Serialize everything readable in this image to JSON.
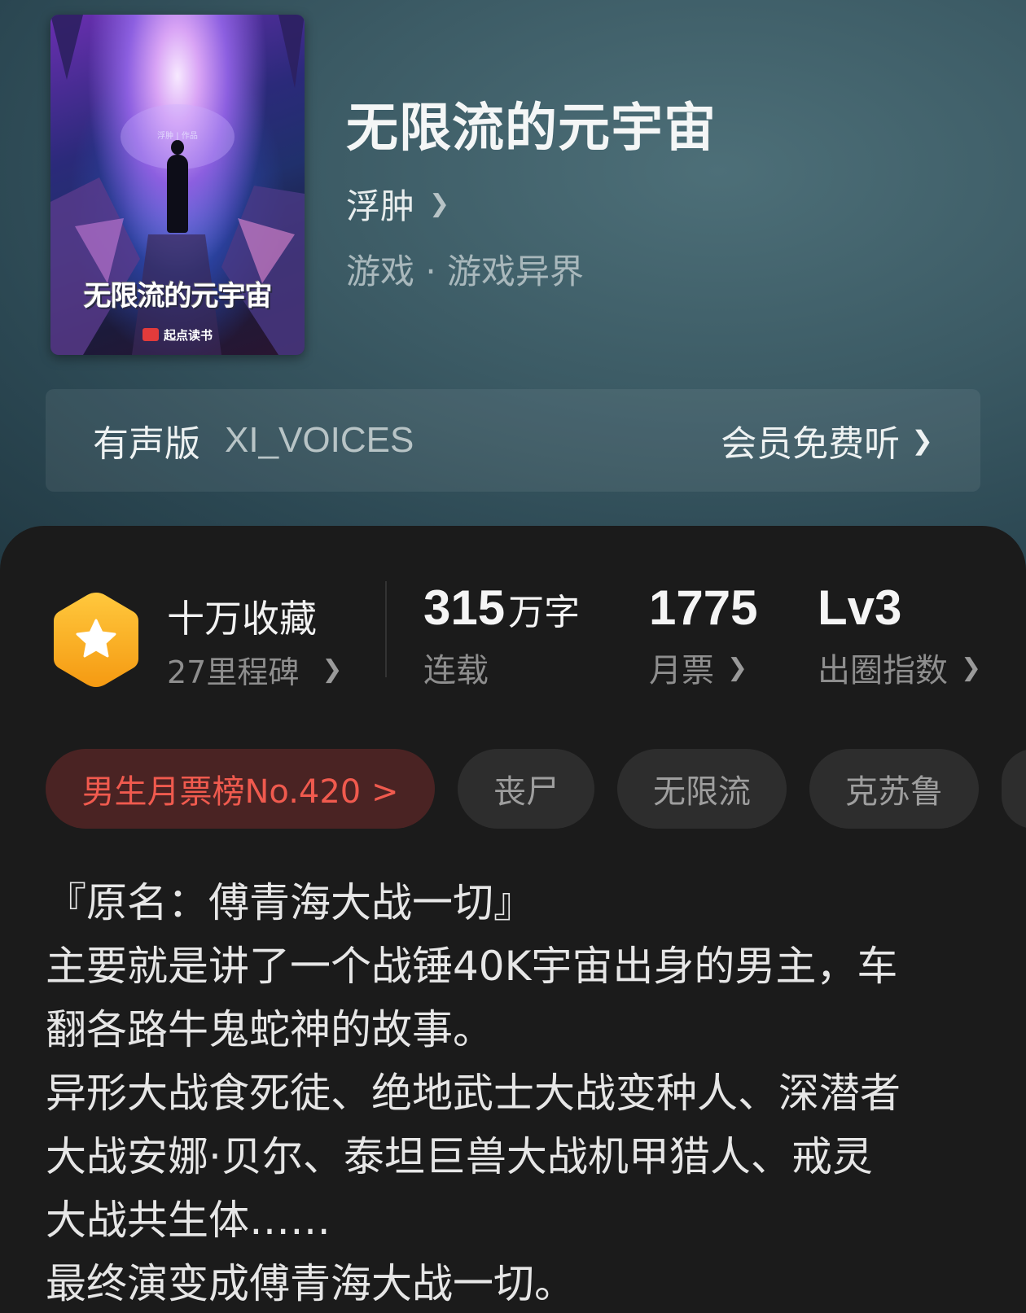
{
  "book": {
    "title": "无限流的元宇宙",
    "author": "浮肿",
    "genre": "游戏 · 游戏异界",
    "cover": {
      "title_art": "无限流的元宇宙",
      "publisher": "起点读书",
      "byline": "浮肿 | 作品"
    }
  },
  "audio": {
    "label": "有声版",
    "voice": "XI_VOICES",
    "cta": "会员免费听"
  },
  "stats": {
    "favorites": {
      "title": "十万收藏",
      "sub": "27里程碑"
    },
    "words": {
      "value": "315",
      "unit": "万字",
      "label": "连载"
    },
    "monthly_tickets": {
      "value": "1775",
      "label": "月票"
    },
    "level": {
      "value": "Lv3",
      "label": "出圈指数"
    }
  },
  "tags": {
    "rank": "男生月票榜No.420 >",
    "items": [
      "丧尸",
      "无限流",
      "克苏鲁",
      ""
    ]
  },
  "description": [
    "『原名：傅青海大战一切』",
    "主要就是讲了一个战锤40K宇宙出身的男主，车",
    "翻各路牛鬼蛇神的故事。",
    "异形大战食死徒、绝地武士大战变种人、深潜者",
    "大战安娜·贝尔、泰坦巨兽大战机甲猎人、戒灵",
    "大战共生体……",
    "最终演变成傅青海大战一切。"
  ],
  "icons": {
    "badge": "star-hexagon-icon",
    "chevron": "chevron-right-icon"
  },
  "colors": {
    "badge": "#f7a623",
    "rank_text": "#f05a4e",
    "rank_bg": "#4a2323",
    "panel_bg": "#1b1b1b"
  }
}
